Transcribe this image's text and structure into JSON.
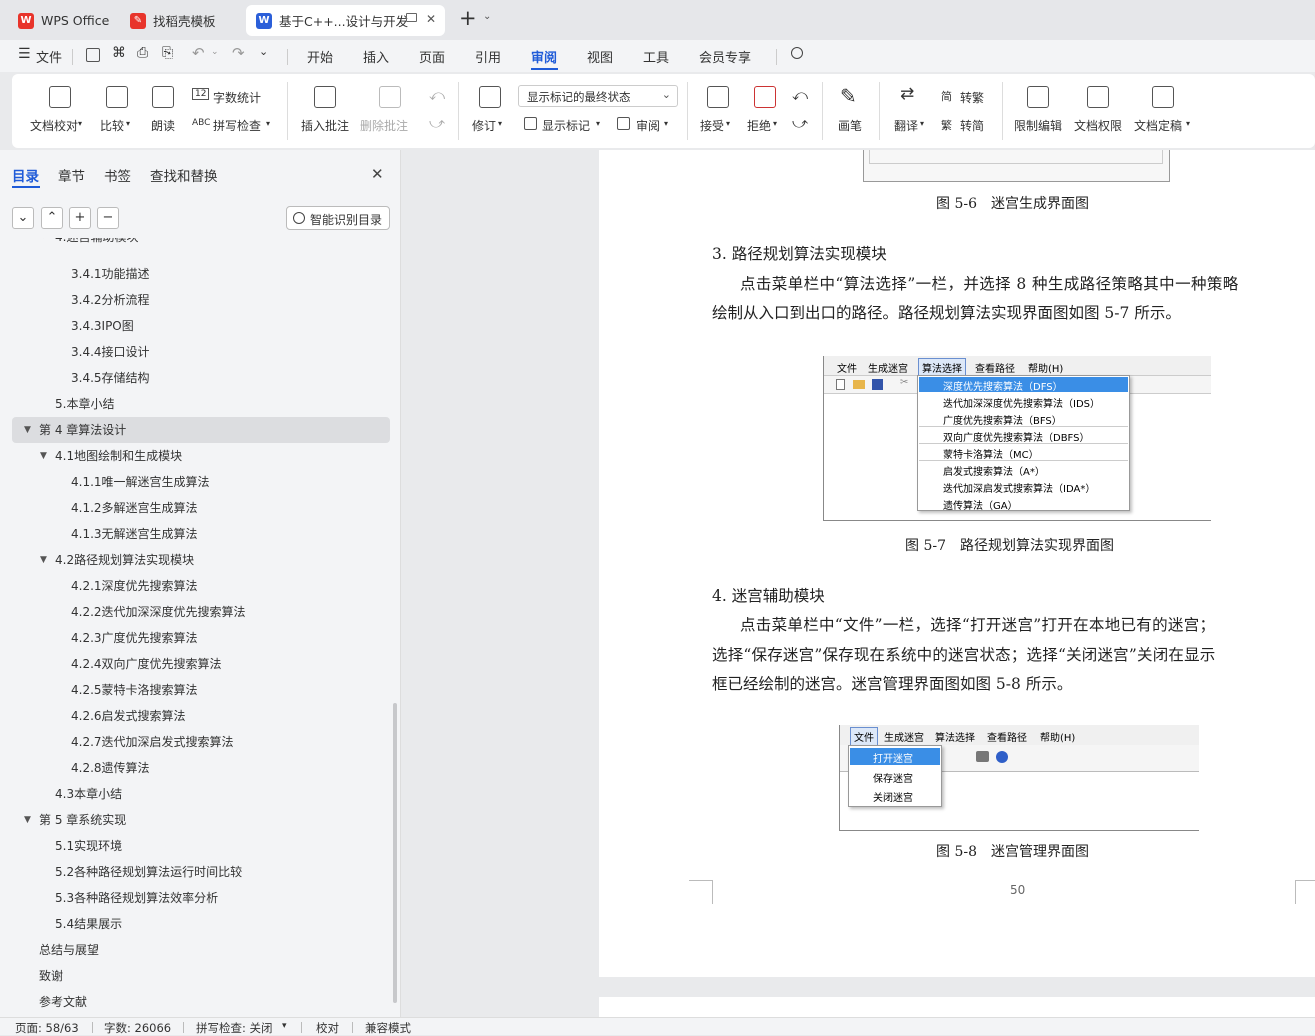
{
  "tabs": [
    {
      "label": "WPS Office",
      "close": ""
    },
    {
      "label": "找稻壳模板",
      "close": ""
    },
    {
      "label": "基于C++...设计与开发",
      "close": "✕"
    }
  ],
  "new_tab": "+",
  "menu": {
    "file": "文件",
    "items": [
      "开始",
      "插入",
      "页面",
      "引用",
      "审阅",
      "视图",
      "工具",
      "会员专享"
    ],
    "active": "审阅"
  },
  "ribbon": {
    "doc_check": "文档校对",
    "compare": "比较",
    "read_aloud": "朗读",
    "word_count": "字数统计",
    "spell_check": "拼写检查",
    "insert_comment": "插入批注",
    "delete_comment": "删除批注",
    "revise": "修订",
    "show_state": "显示标记的最终状态",
    "show_markup": "显示标记",
    "review_pane": "审阅",
    "accept": "接受",
    "reject": "拒绝",
    "pen": "画笔",
    "translate": "翻译",
    "trad": "转繁",
    "simp": "转简",
    "restrict": "限制编辑",
    "permission": "文档权限",
    "finalize": "文档定稿"
  },
  "sidebar": {
    "tabs": [
      "目录",
      "章节",
      "书签",
      "查找和替换"
    ],
    "smart_toc": "智能识别目录",
    "items": [
      "3.4.1功能描述",
      "3.4.2分析流程",
      "3.4.3IPO图",
      "3.4.4接口设计",
      "3.4.5存储结构",
      "5.本章小结",
      "第 4 章算法设计",
      "4.1地图绘制和生成模块",
      "4.1.1唯一解迷宫生成算法",
      "4.1.2多解迷宫生成算法",
      "4.1.3无解迷宫生成算法",
      "4.2路径规划算法实现模块",
      "4.2.1深度优先搜索算法",
      "4.2.2迭代加深深度优先搜索算法",
      "4.2.3广度优先搜索算法",
      "4.2.4双向广度优先搜索算法",
      "4.2.5蒙特卡洛搜索算法",
      "4.2.6启发式搜索算法",
      "4.2.7迭代加深启发式搜索算法",
      "4.2.8遗传算法",
      "4.3本章小结",
      "第 5 章系统实现",
      "5.1实现环境",
      "5.2各种路径规划算法运行时间比较",
      "5.3各种路径规划算法效率分析",
      "5.4结果展示",
      "总结与展望",
      "致谢",
      "参考文献"
    ]
  },
  "document": {
    "caption56": "图 5-6　迷宫生成界面图",
    "h3": "3.  路径规划算法实现模块",
    "p3a": "点击菜单栏中“算法选择”一栏，并选择 8 种生成路径策略其中一种策略",
    "p3b": "绘制从入口到出口的路径。路径规划算法实现界面图如图 5-7 所示。",
    "caption57": "图 5-7　路径规划算法实现界面图",
    "h4": "4.  迷宫辅助模块",
    "p4a": "点击菜单栏中“文件”一栏，选择“打开迷宫”打开在本地已有的迷宫；",
    "p4b": "选择“保存迷宫”保存现在系统中的迷宫状态；选择“关闭迷宫”关闭在显示",
    "p4c": "框已经绘制的迷宫。迷宫管理界面图如图 5-8 所示。",
    "caption58": "图 5-8　迷宫管理界面图",
    "page_number": "50"
  },
  "shot57": {
    "menu": [
      "文件",
      "生成迷宫",
      "算法选择",
      "查看路径",
      "帮助(H)"
    ],
    "items": [
      "深度优先搜索算法（DFS）",
      "迭代加深深度优先搜索算法（IDS）",
      "广度优先搜索算法（BFS）",
      "双向广度优先搜索算法（DBFS）",
      "蒙特卡洛算法（MC）",
      "启发式搜索算法（A*）",
      "迭代加深启发式搜索算法（IDA*）",
      "遗传算法（GA）"
    ]
  },
  "shot58": {
    "menu": [
      "文件",
      "生成迷宫",
      "算法选择",
      "查看路径",
      "帮助(H)"
    ],
    "items": [
      "打开迷宫",
      "保存迷宫",
      "关闭迷宫"
    ]
  },
  "status": {
    "page": "页面: 58/63",
    "words": "字数: 26066",
    "spell": "拼写检查: 关闭",
    "proof": "校对",
    "compat": "兼容模式"
  }
}
